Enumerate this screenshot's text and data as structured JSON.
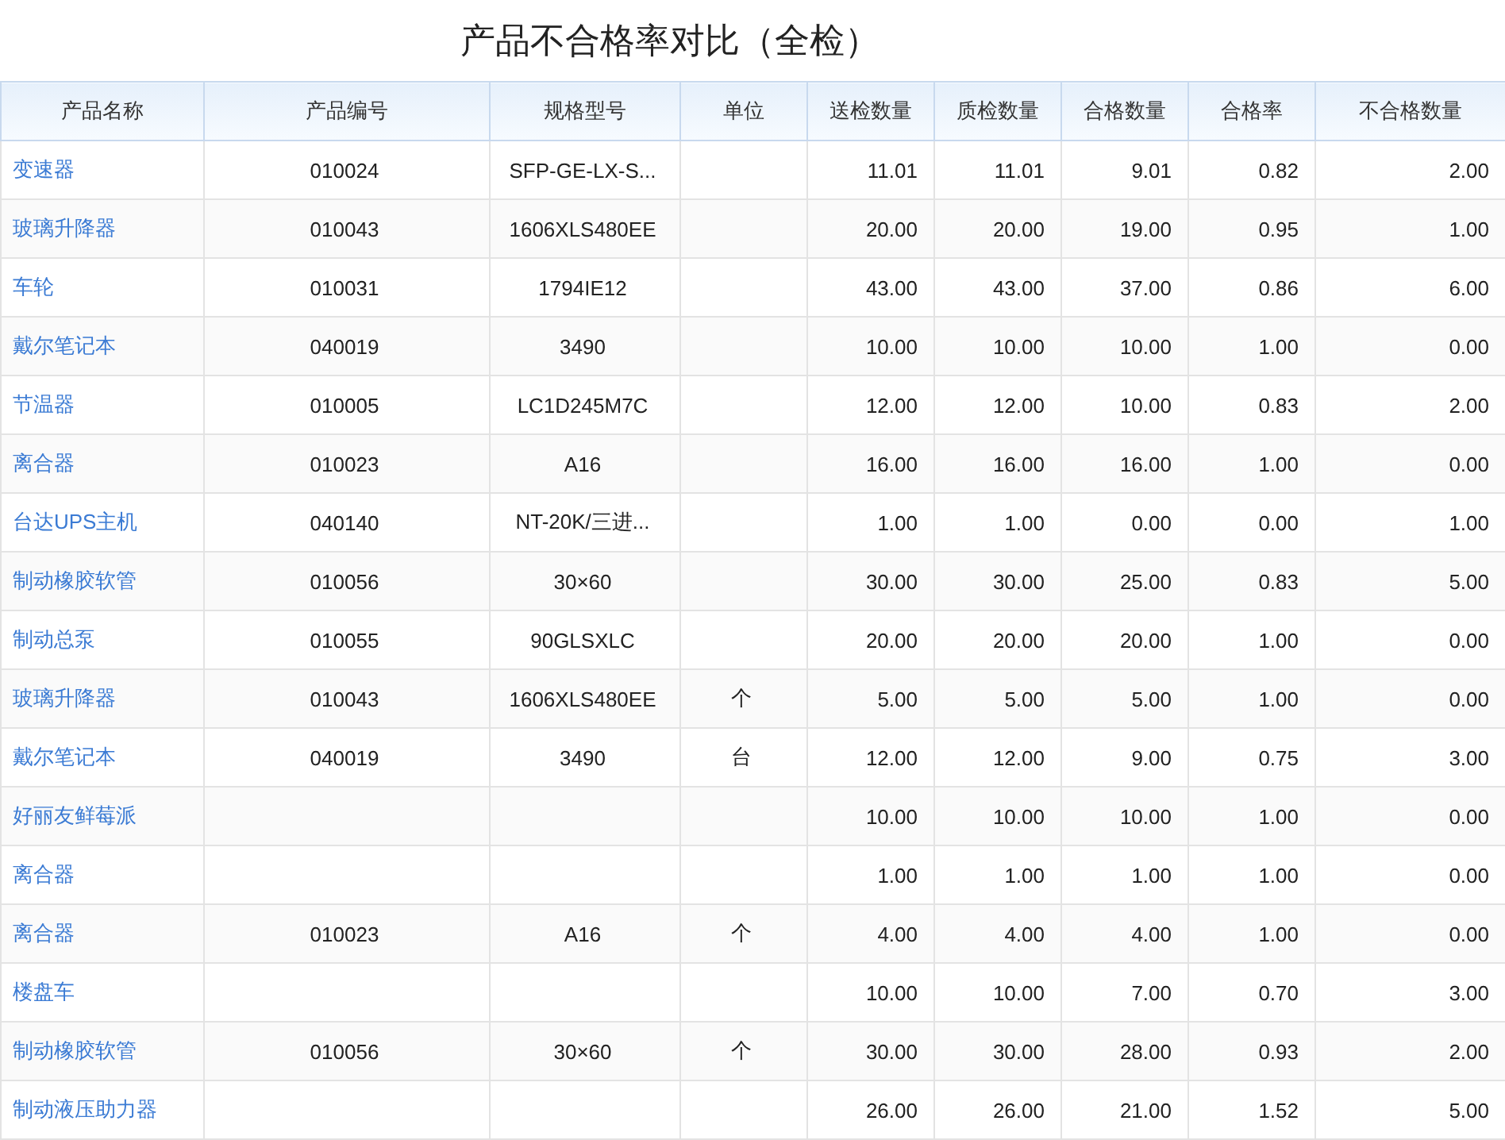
{
  "title": "产品不合格率对比（全检）",
  "table": {
    "columns": [
      "产品名称",
      "产品编号",
      "规格型号",
      "单位",
      "送检数量",
      "质检数量",
      "合格数量",
      "合格率",
      "不合格数量"
    ],
    "rows": [
      {
        "name": "变速器",
        "code": "010024",
        "spec": "SFP-GE-LX-S...",
        "sent": "11.01",
        "inspected": "11.01",
        "passed": "9.01",
        "rate": "0.82",
        "failed": "2.00"
      },
      {
        "name": "玻璃升降器",
        "code": "010043",
        "spec": "1606XLS480EE",
        "sent": "20.00",
        "inspected": "20.00",
        "passed": "19.00",
        "rate": "0.95",
        "failed": "1.00"
      },
      {
        "name": "车轮",
        "code": "010031",
        "spec": "1794IE12",
        "sent": "43.00",
        "inspected": "43.00",
        "passed": "37.00",
        "rate": "0.86",
        "failed": "6.00"
      },
      {
        "name": "戴尔笔记本",
        "code": "040019",
        "spec": "3490",
        "sent": "10.00",
        "inspected": "10.00",
        "passed": "10.00",
        "rate": "1.00",
        "failed": "0.00"
      },
      {
        "name": "节温器",
        "code": "010005",
        "spec": "LC1D245M7C",
        "sent": "12.00",
        "inspected": "12.00",
        "passed": "10.00",
        "rate": "0.83",
        "failed": "2.00"
      },
      {
        "name": "离合器",
        "code": "010023",
        "spec": "A16",
        "sent": "16.00",
        "inspected": "16.00",
        "passed": "16.00",
        "rate": "1.00",
        "failed": "0.00"
      },
      {
        "name": "台达UPS主机",
        "code": "040140",
        "spec": "NT-20K/三进...",
        "sent": "1.00",
        "inspected": "1.00",
        "passed": "0.00",
        "rate": "0.00",
        "failed": "1.00"
      },
      {
        "name": "制动橡胶软管",
        "code": "010056",
        "spec": "30×60",
        "sent": "30.00",
        "inspected": "30.00",
        "passed": "25.00",
        "rate": "0.83",
        "failed": "5.00"
      },
      {
        "name": "制动总泵",
        "code": "010055",
        "spec": "90GLSXLC",
        "sent": "20.00",
        "inspected": "20.00",
        "passed": "20.00",
        "rate": "1.00",
        "failed": "0.00"
      },
      {
        "name": "玻璃升降器",
        "code": "010043",
        "spec": "1606XLS480EE",
        "unit": "个",
        "sent": "5.00",
        "inspected": "5.00",
        "passed": "5.00",
        "rate": "1.00",
        "failed": "0.00"
      },
      {
        "name": "戴尔笔记本",
        "code": "040019",
        "spec": "3490",
        "unit": "台",
        "sent": "12.00",
        "inspected": "12.00",
        "passed": "9.00",
        "rate": "0.75",
        "failed": "3.00"
      },
      {
        "name": "好丽友鲜莓派",
        "sent": "10.00",
        "inspected": "10.00",
        "passed": "10.00",
        "rate": "1.00",
        "failed": "0.00"
      },
      {
        "name": "离合器",
        "sent": "1.00",
        "inspected": "1.00",
        "passed": "1.00",
        "rate": "1.00",
        "failed": "0.00"
      },
      {
        "name": "离合器",
        "code": "010023",
        "spec": "A16",
        "unit": "个",
        "sent": "4.00",
        "inspected": "4.00",
        "passed": "4.00",
        "rate": "1.00",
        "failed": "0.00"
      },
      {
        "name": "楼盘车",
        "sent": "10.00",
        "inspected": "10.00",
        "passed": "7.00",
        "rate": "0.70",
        "failed": "3.00"
      },
      {
        "name": "制动橡胶软管",
        "code": "010056",
        "spec": "30×60",
        "unit": "个",
        "sent": "30.00",
        "inspected": "30.00",
        "passed": "28.00",
        "rate": "0.93",
        "failed": "2.00"
      },
      {
        "name": "制动液压助力器",
        "sent": "26.00",
        "inspected": "26.00",
        "passed": "21.00",
        "rate": "1.52",
        "failed": "5.00"
      }
    ]
  }
}
